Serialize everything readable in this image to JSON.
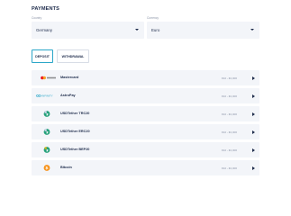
{
  "page": {
    "title": "PAYMENTS"
  },
  "filters": {
    "country": {
      "label": "Country",
      "value": "Germany"
    },
    "currency": {
      "label": "Currency",
      "value": "Euro"
    }
  },
  "tabs": [
    {
      "label": "DEPOSIT",
      "active": true
    },
    {
      "label": "WITHDRAWAL",
      "active": false
    }
  ],
  "methods": [
    {
      "name": "Mastercard",
      "range": "€10 - €2,000",
      "logo": "mastercard-logo"
    },
    {
      "name": "AstroPay",
      "range": "€10 - €2,000",
      "logo": "infinity-logo",
      "logo_text": "INFINITY"
    },
    {
      "name": "USDTether TRC20",
      "range": "€10 - €2,000",
      "logo": "tether-logo"
    },
    {
      "name": "USDTether ERC20",
      "range": "€10 - €2,000",
      "logo": "tether-logo"
    },
    {
      "name": "USDTether BEP20",
      "range": "€10 - €2,000",
      "logo": "tether-logo"
    },
    {
      "name": "Bitcoin",
      "range": "€10 - €2,000",
      "logo": "bitcoin-logo"
    }
  ],
  "colors": {
    "accent": "#2aa6c8",
    "row_bg": "#f3f5f9",
    "text": "#1c2a4a",
    "tether": "#26a17b",
    "bitcoin": "#f7931a"
  }
}
